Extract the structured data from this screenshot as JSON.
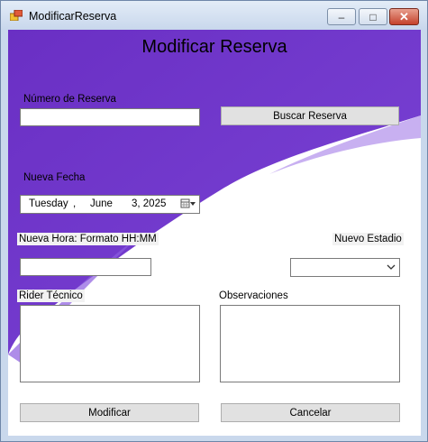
{
  "window": {
    "title": "ModificarReserva",
    "controls": {
      "minimize": "–",
      "maximize": "□",
      "close": "✕"
    },
    "icon": "app-window-icon"
  },
  "form": {
    "heading": "Modificar Reserva",
    "numero_reserva": {
      "label": "Número de Reserva",
      "value": ""
    },
    "buscar_button": "Buscar Reserva",
    "nueva_fecha": {
      "label": "Nueva Fecha",
      "weekday": "Tuesday",
      "sep1": ",",
      "month": "June",
      "day_year": "3, 2025",
      "icon": "calendar-dropdown-icon"
    },
    "nueva_hora": {
      "label": "Nueva Hora: Formato HH:MM",
      "value": ""
    },
    "nuevo_estadio": {
      "label": "Nuevo Estadio",
      "selected": "",
      "icon": "chevron-down-icon"
    },
    "rider_tecnico": {
      "label": "Rider Técnico",
      "value": ""
    },
    "observaciones": {
      "label": "Observaciones",
      "value": ""
    },
    "modificar_button": "Modificar",
    "cancelar_button": "Cancelar"
  },
  "colors": {
    "purple_dark": "#6a2fc4",
    "purple_light": "#8b5ce0",
    "frame": "#c9d8ec"
  }
}
